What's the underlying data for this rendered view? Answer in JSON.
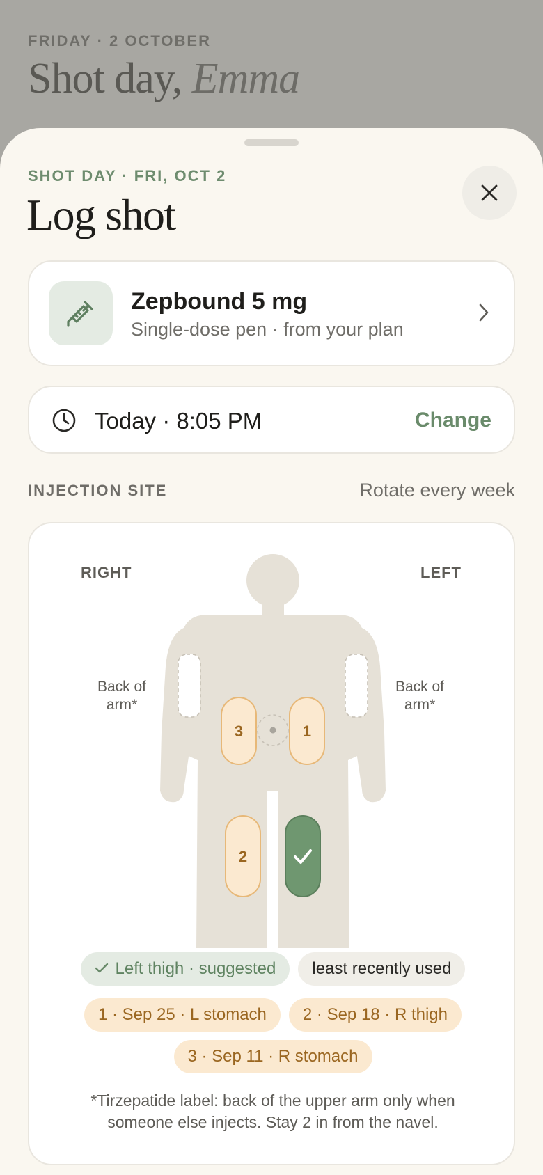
{
  "background": {
    "date": "FRIDAY · 2 OCTOBER",
    "title_main": "Shot day, ",
    "title_name": "Emma"
  },
  "sheet": {
    "eyebrow": "SHOT DAY · FRI, OCT 2",
    "title": "Log shot",
    "close_icon": "close-icon"
  },
  "medication": {
    "icon": "syringe-icon",
    "name": "Zepbound 5 mg",
    "subtitle": "Single-dose pen · from your plan"
  },
  "time": {
    "icon": "clock-icon",
    "value": "Today · 8:05 PM",
    "change_label": "Change"
  },
  "injection_site": {
    "label": "INJECTION SITE",
    "hint": "Rotate every week",
    "side_right": "RIGHT",
    "side_left": "LEFT",
    "arm_note_right": "Back of arm*",
    "arm_note_left": "Back of arm*",
    "sites": {
      "stomach_right": "3",
      "stomach_left": "1",
      "thigh_right": "2",
      "thigh_left": "selected"
    },
    "suggestion_chip": "Left thigh · suggested",
    "reason_chip": "least recently used",
    "history": [
      "1 · Sep 25 · L stomach",
      "2 · Sep 18 · R thigh",
      "3 · Sep 11 · R stomach"
    ],
    "footnote": "*Tirzepatide label: back of the upper arm only when someone else injects. Stay 2 in from the navel."
  },
  "colors": {
    "accent_green": "#6a8b6b",
    "selected_site": "#6f9770",
    "history_site": "#fbe9d0",
    "history_text": "#9a6620",
    "body_fill": "#e6e1d7"
  }
}
